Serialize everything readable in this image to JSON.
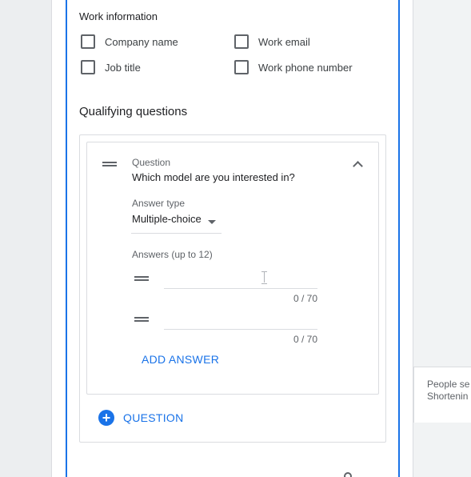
{
  "work_information": {
    "title": "Work information",
    "fields": [
      {
        "label": "Company name",
        "checked": false
      },
      {
        "label": "Work email",
        "checked": false
      },
      {
        "label": "Job title",
        "checked": false
      },
      {
        "label": "Work phone number",
        "checked": false
      }
    ]
  },
  "qualifying": {
    "title": "Qualifying questions",
    "question": {
      "label": "Question",
      "text": "Which model are you interested in?",
      "answer_type_label": "Answer type",
      "answer_type_value": "Multiple-choice",
      "answers_label": "Answers (up to 12)",
      "answers": [
        {
          "value": "",
          "counter": "0 / 70"
        },
        {
          "value": "",
          "counter": "0 / 70"
        }
      ],
      "add_answer_label": "ADD ANSWER"
    },
    "add_question_label": "QUESTION"
  },
  "side_panel": {
    "text": "People se language Shortenin"
  },
  "colors": {
    "accent": "#1a73e8",
    "text": "#202124",
    "secondary_text": "#5f6368",
    "border": "#dadce0"
  }
}
